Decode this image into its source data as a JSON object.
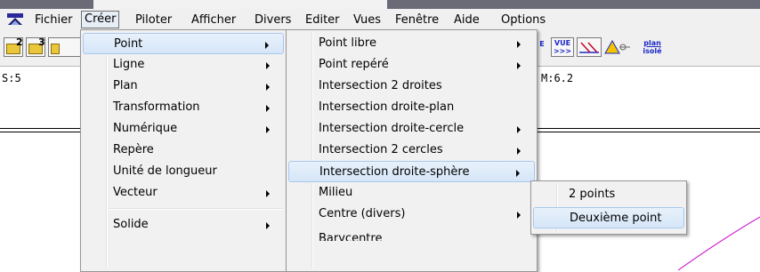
{
  "menubar": {
    "items": [
      "Fichier",
      "Créer",
      "Piloter",
      "Afficher",
      "Divers",
      "Editer",
      "Vues",
      "Fenêtre",
      "Aide",
      "Options"
    ],
    "active": "Créer"
  },
  "toolbar": {
    "open2_sup": "2",
    "open3_sup": "3",
    "vue1": "E",
    "vue2_top": "VUE",
    "vue2_bottom": ">>>",
    "plan_top": "plan",
    "plan_bottom": "isolé"
  },
  "status": {
    "left": "S:5",
    "right": "M:6.2"
  },
  "menu_creer": {
    "items": [
      {
        "label": "Point",
        "submenu": true,
        "highlighted": true
      },
      {
        "label": "Ligne",
        "submenu": true
      },
      {
        "label": "Plan",
        "submenu": true
      },
      {
        "label": "Transformation",
        "submenu": true
      },
      {
        "label": "Numérique",
        "submenu": true
      },
      {
        "label": "Repère",
        "submenu": false
      },
      {
        "label": "Unité de longueur",
        "submenu": false
      },
      {
        "label": "Vecteur",
        "submenu": true
      },
      {
        "label": "Solide",
        "submenu": true
      }
    ]
  },
  "menu_point": {
    "items": [
      {
        "label": "Point libre",
        "submenu": true
      },
      {
        "label": "Point repéré",
        "submenu": true
      },
      {
        "label": "Intersection 2 droites",
        "submenu": false
      },
      {
        "label": "Intersection droite-plan",
        "submenu": false
      },
      {
        "label": "Intersection droite-cercle",
        "submenu": true
      },
      {
        "label": "Intersection 2 cercles",
        "submenu": true
      },
      {
        "label": "Intersection droite-sphère",
        "submenu": true,
        "highlighted": true
      },
      {
        "label": "Milieu",
        "submenu": false
      },
      {
        "label": "Centre (divers)",
        "submenu": true
      },
      {
        "label": "Barycentre",
        "submenu": false
      }
    ]
  },
  "menu_sphere": {
    "items": [
      {
        "label": "2 points"
      },
      {
        "label": "Deuxième point",
        "highlighted": true
      }
    ]
  },
  "colors": {
    "menu_bg": "#f1f1f1",
    "highlight": "#d5e6f8",
    "curve": "#c800c8"
  }
}
